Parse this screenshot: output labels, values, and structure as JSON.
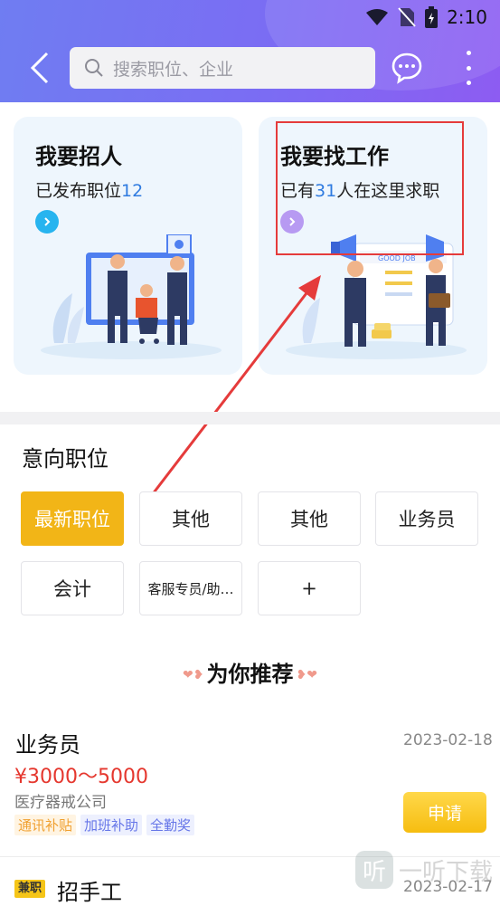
{
  "status_bar": {
    "time": "2:10"
  },
  "header": {
    "search_placeholder": "搜索职位、企业"
  },
  "cards": {
    "recruit": {
      "title": "我要招人",
      "sub_prefix": "已发布职位",
      "count": "12",
      "sub_suffix": ""
    },
    "find_job": {
      "title": "我要找工作",
      "sub_prefix": "已有",
      "count": "31",
      "sub_suffix": "人在这里求职",
      "illustration_text": "GOOD JOB"
    }
  },
  "intent_section": {
    "title": "意向职位",
    "tags": [
      "最新职位",
      "其他",
      "其他",
      "业务员",
      "会计",
      "客服专员/助…",
      "+"
    ]
  },
  "recommend": {
    "title": "为你推荐"
  },
  "jobs": [
    {
      "name": "业务员",
      "date": "2023-02-18",
      "salary": "¥3000～5000",
      "company": "医疗器戒公司",
      "benefits": [
        "通讯补贴",
        "加班补助",
        "全勤奖"
      ],
      "apply_label": "申请"
    },
    {
      "badge": "兼职",
      "name": "招手工",
      "date": "2023-02-17"
    }
  ],
  "watermark": {
    "logo": "听",
    "text": "一听下载"
  },
  "colors": {
    "accent": "#f2b517",
    "header_start": "#6f7df2",
    "header_end": "#8d5cf2",
    "salary": "#e5372e",
    "annotation": "#e53b3b"
  }
}
